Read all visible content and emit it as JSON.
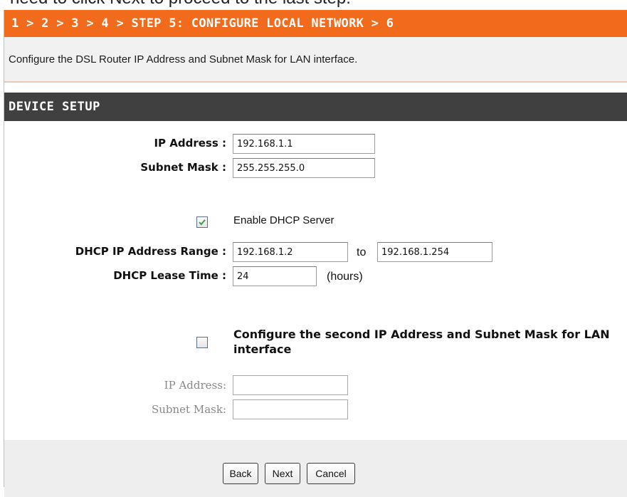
{
  "top_cut_text": "need to click Next to proceed to the last step.",
  "wizard": {
    "step_trail": "1 > 2 > 3 > 4 > STEP 5: CONFIGURE LOCAL NETWORK > 6",
    "description": "Configure the DSL Router IP Address and Subnet Mask for LAN interface."
  },
  "section": {
    "title": "DEVICE SETUP"
  },
  "form": {
    "ip_address_label": "IP Address :",
    "ip_address_value": "192.168.1.1",
    "subnet_mask_label": "Subnet Mask :",
    "subnet_mask_value": "255.255.255.0",
    "enable_dhcp_label": "Enable DHCP Server",
    "enable_dhcp_checked": true,
    "dhcp_range_label": "DHCP IP Address Range :",
    "dhcp_range_start": "192.168.1.2",
    "dhcp_range_to": "to",
    "dhcp_range_end": "192.168.1.254",
    "lease_label": "DHCP Lease Time :",
    "lease_value": "24",
    "lease_unit": "(hours)",
    "second_ip_label": "Configure the second IP Address and Subnet Mask for LAN interface",
    "second_ip_checked": false,
    "second_ip_address_label": "IP Address:",
    "second_ip_address_value": "",
    "second_subnet_mask_label": "Subnet Mask:",
    "second_subnet_mask_value": ""
  },
  "buttons": {
    "back": "Back",
    "next": "Next",
    "cancel": "Cancel"
  },
  "colors": {
    "step_bar": "#f26a1b",
    "section_header": "#404040",
    "check_mark": "#3aa04a"
  }
}
